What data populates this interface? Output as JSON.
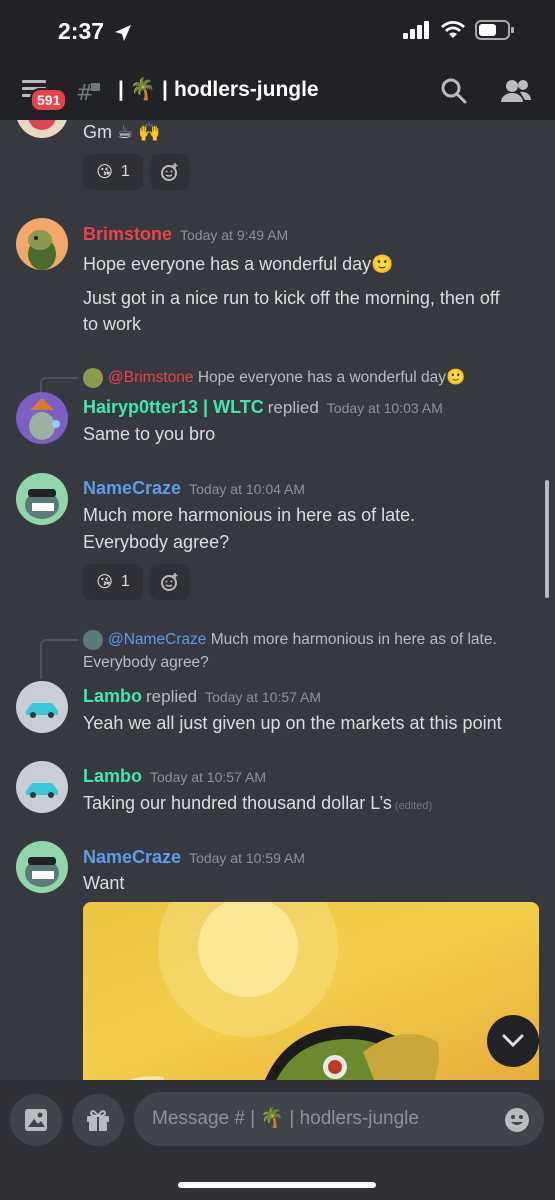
{
  "status_bar": {
    "time": "2:37"
  },
  "header": {
    "badge_count": "591",
    "channel_name": "hodlers-jungle",
    "channel_prefix": "|",
    "channel_emoji": "🌴",
    "channel_suffix": "|"
  },
  "messages": [
    {
      "text": "Gm ☕ 🙌",
      "reaction_emoji": "😘",
      "reaction_count": "1"
    },
    {
      "author": "Brimstone",
      "author_color": "#ed4245",
      "timestamp": "Today at 9:49 AM",
      "line1": "Hope everyone has a wonderful day🙂",
      "line2": "Just got in a nice run to kick off the morning, then off",
      "line3": "to work"
    },
    {
      "reply_to": "@Brimstone",
      "reply_to_color": "#ed4245",
      "reply_preview": "Hope everyone has a wonderful day🙂",
      "author": "Hairyp0tter13 | WLTC",
      "author_color": "#3ee8b0",
      "replied_label": "replied",
      "timestamp": "Today at 10:03 AM",
      "line1": "Same to you bro"
    },
    {
      "author": "NameCraze",
      "author_color": "#5d9cec",
      "timestamp": "Today at 10:04 AM",
      "line1": "Much more harmonious in here as of late.",
      "line2": "Everybody agree?",
      "reaction_emoji": "😘",
      "reaction_count": "1"
    },
    {
      "reply_to": "@NameCraze",
      "reply_to_color": "#5d9cec",
      "reply_preview_line1": "Much more harmonious in here as of late.",
      "reply_preview_line2": "Everybody agree?",
      "author": "Lambo",
      "author_color": "#3ee8b0",
      "replied_label": "replied",
      "timestamp": "Today at 10:57 AM",
      "line1": "Yeah we all just given up on the markets at this point"
    },
    {
      "author": "Lambo",
      "author_color": "#3ee8b0",
      "timestamp": "Today at 10:57 AM",
      "line1": "Taking our hundred thousand dollar L’s",
      "edited_label": "(edited)"
    },
    {
      "author": "NameCraze",
      "author_color": "#5d9cec",
      "timestamp": "Today at 10:59 AM",
      "line1": "Want"
    }
  ],
  "composer": {
    "placeholder": "Message # | 🌴 | hodlers-jungle"
  },
  "colors": {
    "background": "#36393f",
    "header": "#202225",
    "input": "#40444b"
  }
}
